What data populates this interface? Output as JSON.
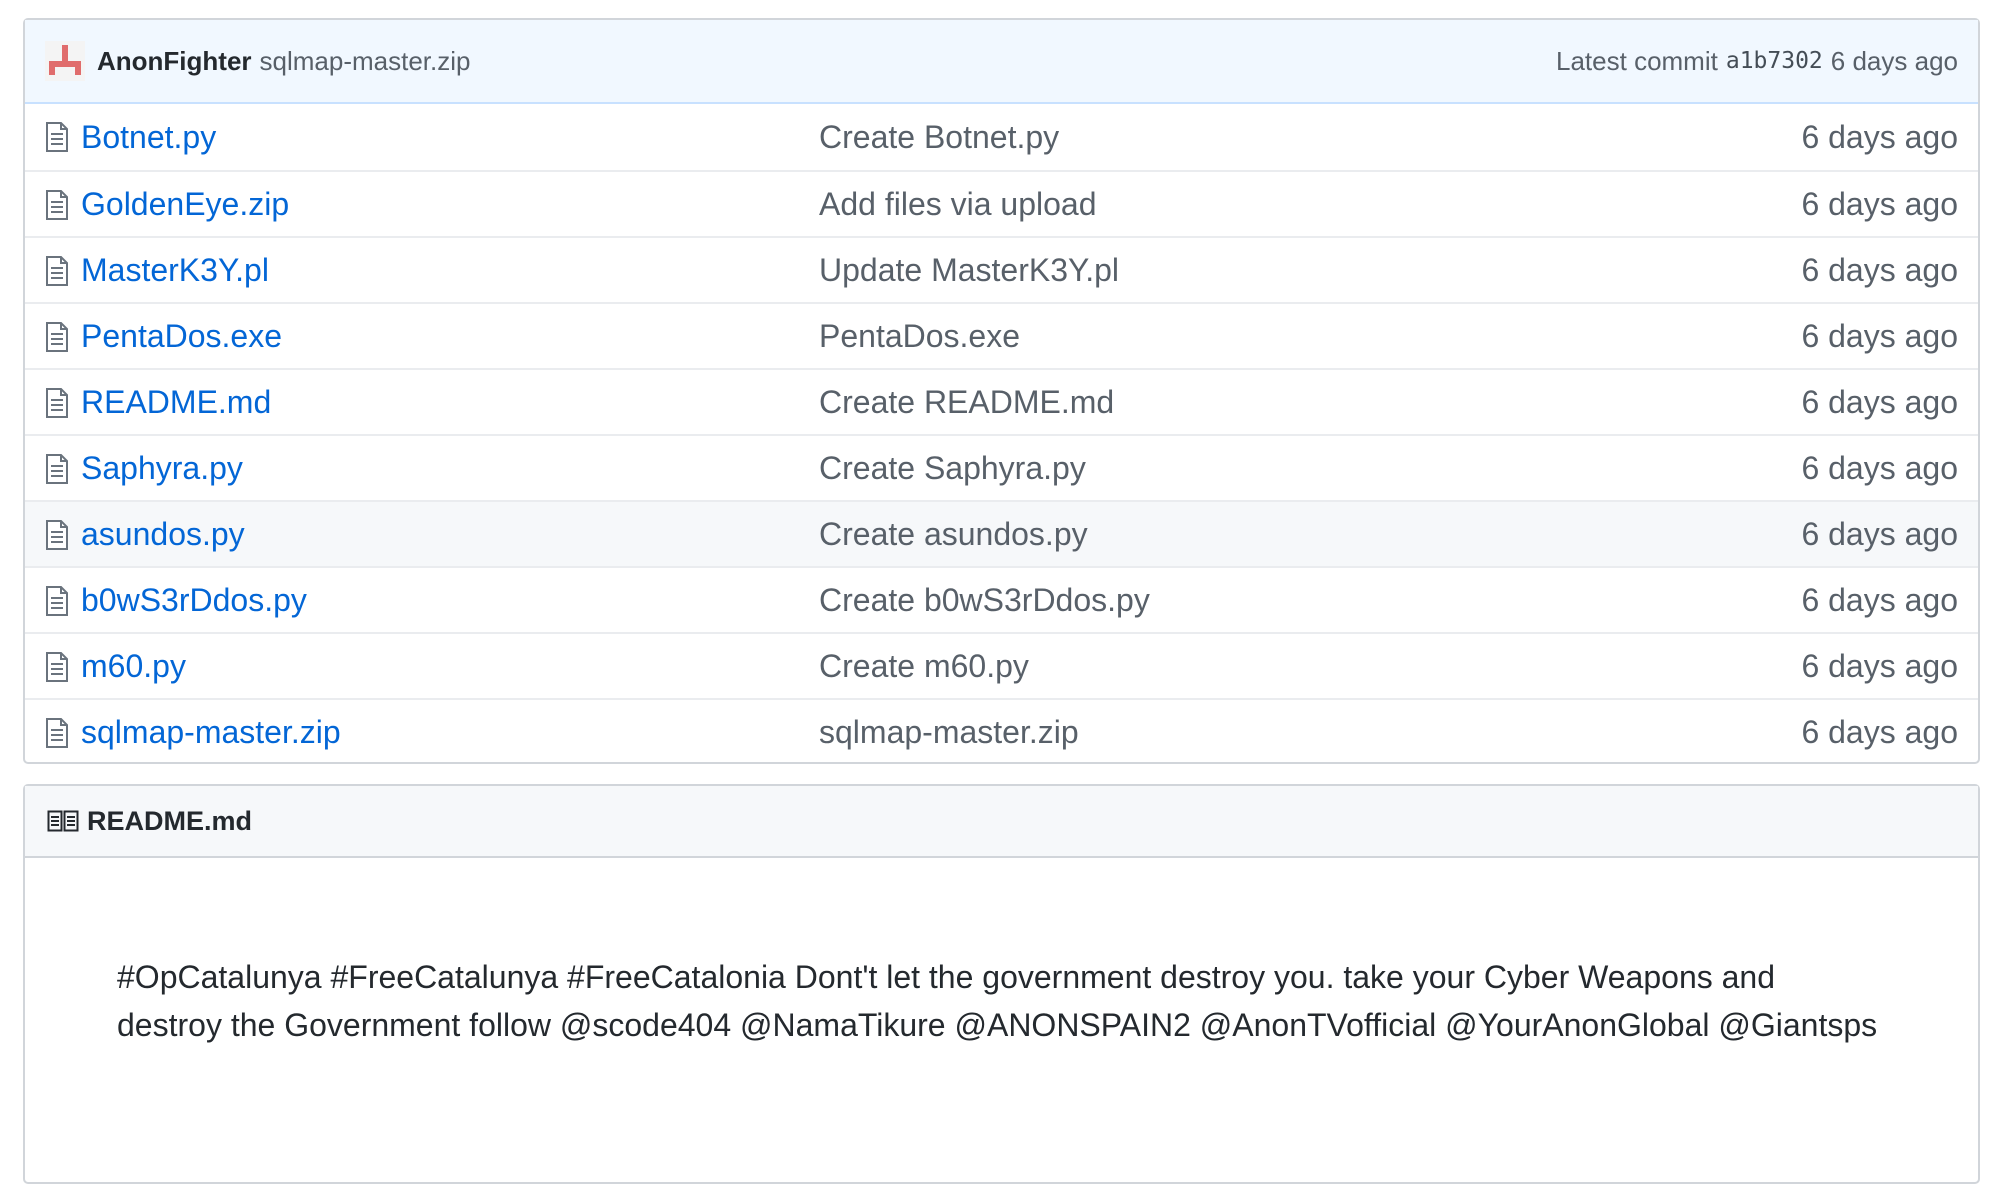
{
  "commit": {
    "author": "AnonFighter",
    "message": "sqlmap-master.zip",
    "latest_label": "Latest commit",
    "sha": "a1b7302",
    "age": "6 days ago"
  },
  "files": [
    {
      "name": "Botnet.py",
      "message": "Create Botnet.py",
      "age": "6 days ago"
    },
    {
      "name": "GoldenEye.zip",
      "message": "Add files via upload",
      "age": "6 days ago"
    },
    {
      "name": "MasterK3Y.pl",
      "message": "Update MasterK3Y.pl",
      "age": "6 days ago"
    },
    {
      "name": "PentaDos.exe",
      "message": "PentaDos.exe",
      "age": "6 days ago"
    },
    {
      "name": "README.md",
      "message": "Create README.md",
      "age": "6 days ago"
    },
    {
      "name": "Saphyra.py",
      "message": "Create Saphyra.py",
      "age": "6 days ago"
    },
    {
      "name": "asundos.py",
      "message": "Create asundos.py",
      "age": "6 days ago"
    },
    {
      "name": "b0wS3rDdos.py",
      "message": "Create b0wS3rDdos.py",
      "age": "6 days ago"
    },
    {
      "name": "m60.py",
      "message": "Create m60.py",
      "age": "6 days ago"
    },
    {
      "name": "sqlmap-master.zip",
      "message": "sqlmap-master.zip",
      "age": "6 days ago"
    }
  ],
  "readme": {
    "title": "README.md",
    "text": "#OpCatalunya #FreeCatalunya #FreeCatalonia Dont't let the government destroy you. take your Cyber Weapons and destroy the Government follow @scode404 @NamaTikure @ANONSPAIN2 @AnonTVofficial @YourAnonGlobal @Giantsps"
  },
  "icons": {
    "avatar": "avatar-identicon",
    "file": "file-icon",
    "readme": "book-icon"
  },
  "colors": {
    "link": "#0366d6",
    "muted": "#586069",
    "commit_bar_bg": "#f1f8ff",
    "avatar": "#e06c6c"
  }
}
